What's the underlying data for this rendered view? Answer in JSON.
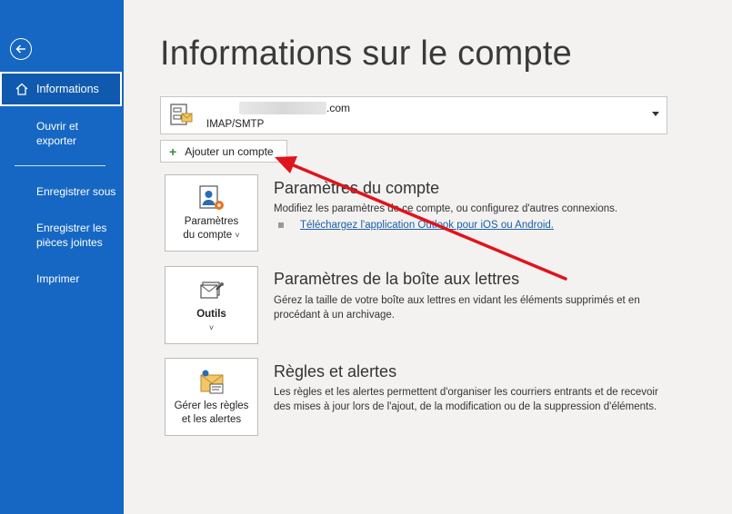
{
  "sidebar": {
    "active_item": "Informations",
    "items": [
      {
        "label": "Ouvrir et"
      },
      {
        "label": "exporter"
      },
      {
        "label": "Enregistrer sous"
      },
      {
        "label": "Enregistrer les"
      },
      {
        "label": "pièces jointes"
      },
      {
        "label": "Imprimer"
      }
    ]
  },
  "main": {
    "title": "Informations sur le compte",
    "account": {
      "email_domain": ".com",
      "type": "IMAP/SMTP"
    },
    "add_account_label": "Ajouter un compte",
    "sections": [
      {
        "tile_line1": "Paramètres",
        "tile_line2": "du compte",
        "title": "Paramètres du compte",
        "description": "Modifiez les paramètres de ce compte, ou configurez d'autres connexions.",
        "link": "Téléchargez l'application Outlook pour iOS ou Android."
      },
      {
        "tile_line1": "Outils",
        "title": "Paramètres de la boîte aux lettres",
        "description": "Gérez la taille de votre boîte aux lettres en vidant les éléments supprimés et en procédant à un archivage."
      },
      {
        "tile_line1": "Gérer les règles",
        "tile_line2": "et les alertes",
        "title": "Règles et alertes",
        "description": "Les règles et les alertes permettent d'organiser les courriers entrants et de recevoir des mises à jour lors de l'ajout, de la modification ou de la suppression d'éléments."
      }
    ]
  },
  "colors": {
    "sidebar": "#1667c3",
    "annotation_arrow": "#e0141c",
    "link": "#1a5ea8"
  }
}
